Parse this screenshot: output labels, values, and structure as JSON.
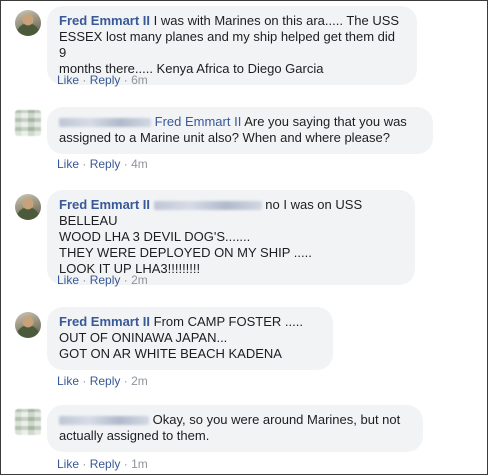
{
  "comments": [
    {
      "author": "Fred Emmart II",
      "lines": [
        "I was with Marines on this ara..... The USS",
        "ESSEX lost many planes and my ship helped get them did 9",
        "months there..... Kenya Africa to Diego Garcia"
      ],
      "like": "Like",
      "reply": "Reply",
      "time": "6m"
    },
    {
      "author": "",
      "mention": "Fred Emmart II",
      "lines": [
        "Are you saying that you was",
        "assigned to a Marine unit also? When and where please?"
      ],
      "like": "Like",
      "reply": "Reply",
      "time": "4m"
    },
    {
      "author": "Fred Emmart II",
      "lines": [
        "no I was on USS BELLEAU",
        "WOOD LHA 3 DEVIL DOG'S.......",
        "THEY WERE DEPLOYED ON MY SHIP .....",
        "LOOK IT UP LHA3!!!!!!!!!"
      ],
      "like": "Like",
      "reply": "Reply",
      "time": "2m"
    },
    {
      "author": "Fred Emmart II",
      "lines": [
        "From CAMP FOSTER .....",
        "OUT OF ONINAWA JAPAN...",
        "GOT ON AR WHITE BEACH KADENA"
      ],
      "like": "Like",
      "reply": "Reply",
      "time": "2m"
    },
    {
      "author": "",
      "lines": [
        "Okay, so you were around Marines, but not",
        "actually assigned to them."
      ],
      "like": "Like",
      "reply": "Reply",
      "time": "1m"
    }
  ],
  "separator": "·"
}
